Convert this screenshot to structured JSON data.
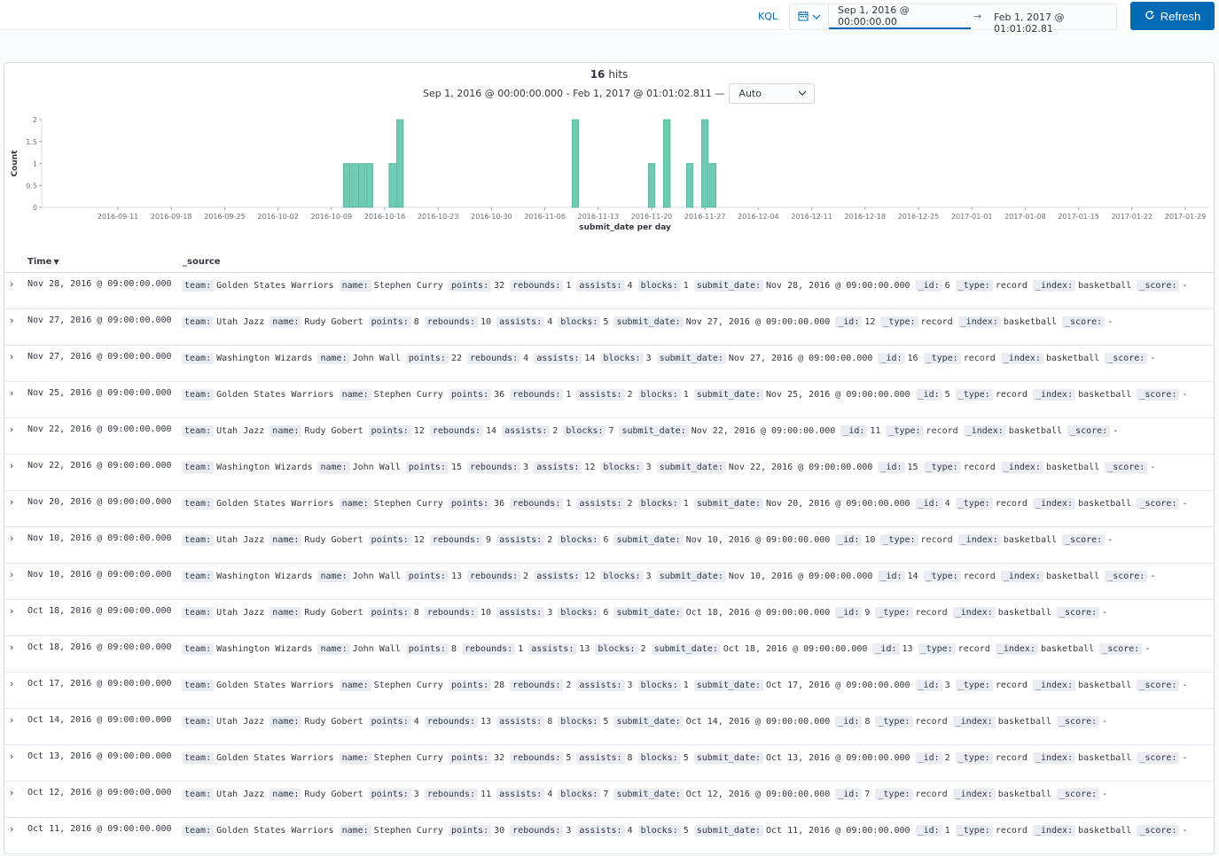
{
  "query_bar": {
    "language": "KQL",
    "date_start": "Sep 1, 2016 @ 00:00:00.00",
    "date_arrow": "→",
    "date_end": "Feb 1, 2017 @ 01:01:02.81",
    "refresh_label": "Refresh"
  },
  "summary": {
    "hits_count": "16",
    "hits_label": "hits",
    "range_text": "Sep 1, 2016 @ 00:00:00.000 - Feb 1, 2017 @ 01:01:02.811 —",
    "interval": "Auto"
  },
  "chart_data": {
    "type": "bar",
    "xlabel": "submit_date per day",
    "ylabel": "Count",
    "ylim": [
      0,
      2
    ],
    "y_ticks": [
      "0",
      "0.5",
      "1",
      "1.5",
      "2"
    ],
    "x_ticks": [
      "2016-09-11",
      "2016-09-18",
      "2016-09-25",
      "2016-10-02",
      "2016-10-09",
      "2016-10-16",
      "2016-10-23",
      "2016-10-30",
      "2016-11-06",
      "2016-11-13",
      "2016-11-20",
      "2016-11-27",
      "2016-12-04",
      "2016-12-11",
      "2016-12-18",
      "2016-12-25",
      "2017-01-01",
      "2017-01-08",
      "2017-01-15",
      "2017-01-22",
      "2017-01-29"
    ],
    "x_start": "2016-09-01",
    "categories": [
      "2016-10-11",
      "2016-10-12",
      "2016-10-13",
      "2016-10-14",
      "2016-10-17",
      "2016-10-18",
      "2016-11-10",
      "2016-11-20",
      "2016-11-22",
      "2016-11-25",
      "2016-11-27",
      "2016-11-28"
    ],
    "values": [
      1,
      1,
      1,
      1,
      1,
      2,
      2,
      1,
      2,
      1,
      2,
      1
    ],
    "color": "#6dccb1"
  },
  "table": {
    "columns": {
      "time": "Time",
      "source": "_source"
    },
    "rows": [
      {
        "time": "Nov 28, 2016 @ 09:00:00.000",
        "fields": [
          [
            "team:",
            "Golden States Warriors"
          ],
          [
            "name:",
            "Stephen Curry"
          ],
          [
            "points:",
            "32"
          ],
          [
            "rebounds:",
            "1"
          ],
          [
            "assists:",
            "4"
          ],
          [
            "blocks:",
            "1"
          ],
          [
            "submit_date:",
            "Nov 28, 2016 @ 09:00:00.000"
          ],
          [
            "_id:",
            "6"
          ],
          [
            "_type:",
            "record"
          ],
          [
            "_index:",
            "basketball"
          ],
          [
            "_score:",
            "-"
          ]
        ]
      },
      {
        "time": "Nov 27, 2016 @ 09:00:00.000",
        "fields": [
          [
            "team:",
            "Utah Jazz"
          ],
          [
            "name:",
            "Rudy Gobert"
          ],
          [
            "points:",
            "8"
          ],
          [
            "rebounds:",
            "10"
          ],
          [
            "assists:",
            "4"
          ],
          [
            "blocks:",
            "5"
          ],
          [
            "submit_date:",
            "Nov 27, 2016 @ 09:00:00.000"
          ],
          [
            "_id:",
            "12"
          ],
          [
            "_type:",
            "record"
          ],
          [
            "_index:",
            "basketball"
          ],
          [
            "_score:",
            "-"
          ]
        ]
      },
      {
        "time": "Nov 27, 2016 @ 09:00:00.000",
        "fields": [
          [
            "team:",
            "Washington Wizards"
          ],
          [
            "name:",
            "John Wall"
          ],
          [
            "points:",
            "22"
          ],
          [
            "rebounds:",
            "4"
          ],
          [
            "assists:",
            "14"
          ],
          [
            "blocks:",
            "3"
          ],
          [
            "submit_date:",
            "Nov 27, 2016 @ 09:00:00.000"
          ],
          [
            "_id:",
            "16"
          ],
          [
            "_type:",
            "record"
          ],
          [
            "_index:",
            "basketball"
          ],
          [
            "_score:",
            "-"
          ]
        ]
      },
      {
        "time": "Nov 25, 2016 @ 09:00:00.000",
        "fields": [
          [
            "team:",
            "Golden States Warriors"
          ],
          [
            "name:",
            "Stephen Curry"
          ],
          [
            "points:",
            "36"
          ],
          [
            "rebounds:",
            "1"
          ],
          [
            "assists:",
            "2"
          ],
          [
            "blocks:",
            "1"
          ],
          [
            "submit_date:",
            "Nov 25, 2016 @ 09:00:00.000"
          ],
          [
            "_id:",
            "5"
          ],
          [
            "_type:",
            "record"
          ],
          [
            "_index:",
            "basketball"
          ],
          [
            "_score:",
            "-"
          ]
        ]
      },
      {
        "time": "Nov 22, 2016 @ 09:00:00.000",
        "fields": [
          [
            "team:",
            "Utah Jazz"
          ],
          [
            "name:",
            "Rudy Gobert"
          ],
          [
            "points:",
            "12"
          ],
          [
            "rebounds:",
            "14"
          ],
          [
            "assists:",
            "2"
          ],
          [
            "blocks:",
            "7"
          ],
          [
            "submit_date:",
            "Nov 22, 2016 @ 09:00:00.000"
          ],
          [
            "_id:",
            "11"
          ],
          [
            "_type:",
            "record"
          ],
          [
            "_index:",
            "basketball"
          ],
          [
            "_score:",
            "-"
          ]
        ]
      },
      {
        "time": "Nov 22, 2016 @ 09:00:00.000",
        "fields": [
          [
            "team:",
            "Washington Wizards"
          ],
          [
            "name:",
            "John Wall"
          ],
          [
            "points:",
            "15"
          ],
          [
            "rebounds:",
            "3"
          ],
          [
            "assists:",
            "12"
          ],
          [
            "blocks:",
            "3"
          ],
          [
            "submit_date:",
            "Nov 22, 2016 @ 09:00:00.000"
          ],
          [
            "_id:",
            "15"
          ],
          [
            "_type:",
            "record"
          ],
          [
            "_index:",
            "basketball"
          ],
          [
            "_score:",
            "-"
          ]
        ]
      },
      {
        "time": "Nov 20, 2016 @ 09:00:00.000",
        "fields": [
          [
            "team:",
            "Golden States Warriors"
          ],
          [
            "name:",
            "Stephen Curry"
          ],
          [
            "points:",
            "36"
          ],
          [
            "rebounds:",
            "1"
          ],
          [
            "assists:",
            "2"
          ],
          [
            "blocks:",
            "1"
          ],
          [
            "submit_date:",
            "Nov 20, 2016 @ 09:00:00.000"
          ],
          [
            "_id:",
            "4"
          ],
          [
            "_type:",
            "record"
          ],
          [
            "_index:",
            "basketball"
          ],
          [
            "_score:",
            "-"
          ]
        ]
      },
      {
        "time": "Nov 10, 2016 @ 09:00:00.000",
        "fields": [
          [
            "team:",
            "Utah Jazz"
          ],
          [
            "name:",
            "Rudy Gobert"
          ],
          [
            "points:",
            "12"
          ],
          [
            "rebounds:",
            "9"
          ],
          [
            "assists:",
            "2"
          ],
          [
            "blocks:",
            "6"
          ],
          [
            "submit_date:",
            "Nov 10, 2016 @ 09:00:00.000"
          ],
          [
            "_id:",
            "10"
          ],
          [
            "_type:",
            "record"
          ],
          [
            "_index:",
            "basketball"
          ],
          [
            "_score:",
            "-"
          ]
        ]
      },
      {
        "time": "Nov 10, 2016 @ 09:00:00.000",
        "fields": [
          [
            "team:",
            "Washington Wizards"
          ],
          [
            "name:",
            "John Wall"
          ],
          [
            "points:",
            "13"
          ],
          [
            "rebounds:",
            "2"
          ],
          [
            "assists:",
            "12"
          ],
          [
            "blocks:",
            "3"
          ],
          [
            "submit_date:",
            "Nov 10, 2016 @ 09:00:00.000"
          ],
          [
            "_id:",
            "14"
          ],
          [
            "_type:",
            "record"
          ],
          [
            "_index:",
            "basketball"
          ],
          [
            "_score:",
            "-"
          ]
        ]
      },
      {
        "time": "Oct 18, 2016 @ 09:00:00.000",
        "fields": [
          [
            "team:",
            "Utah Jazz"
          ],
          [
            "name:",
            "Rudy Gobert"
          ],
          [
            "points:",
            "8"
          ],
          [
            "rebounds:",
            "10"
          ],
          [
            "assists:",
            "3"
          ],
          [
            "blocks:",
            "6"
          ],
          [
            "submit_date:",
            "Oct 18, 2016 @ 09:00:00.000"
          ],
          [
            "_id:",
            "9"
          ],
          [
            "_type:",
            "record"
          ],
          [
            "_index:",
            "basketball"
          ],
          [
            "_score:",
            "-"
          ]
        ]
      },
      {
        "time": "Oct 18, 2016 @ 09:00:00.000",
        "fields": [
          [
            "team:",
            "Washington Wizards"
          ],
          [
            "name:",
            "John Wall"
          ],
          [
            "points:",
            "8"
          ],
          [
            "rebounds:",
            "1"
          ],
          [
            "assists:",
            "13"
          ],
          [
            "blocks:",
            "2"
          ],
          [
            "submit_date:",
            "Oct 18, 2016 @ 09:00:00.000"
          ],
          [
            "_id:",
            "13"
          ],
          [
            "_type:",
            "record"
          ],
          [
            "_index:",
            "basketball"
          ],
          [
            "_score:",
            "-"
          ]
        ]
      },
      {
        "time": "Oct 17, 2016 @ 09:00:00.000",
        "fields": [
          [
            "team:",
            "Golden States Warriors"
          ],
          [
            "name:",
            "Stephen Curry"
          ],
          [
            "points:",
            "28"
          ],
          [
            "rebounds:",
            "2"
          ],
          [
            "assists:",
            "3"
          ],
          [
            "blocks:",
            "1"
          ],
          [
            "submit_date:",
            "Oct 17, 2016 @ 09:00:00.000"
          ],
          [
            "_id:",
            "3"
          ],
          [
            "_type:",
            "record"
          ],
          [
            "_index:",
            "basketball"
          ],
          [
            "_score:",
            "-"
          ]
        ]
      },
      {
        "time": "Oct 14, 2016 @ 09:00:00.000",
        "fields": [
          [
            "team:",
            "Utah Jazz"
          ],
          [
            "name:",
            "Rudy Gobert"
          ],
          [
            "points:",
            "4"
          ],
          [
            "rebounds:",
            "13"
          ],
          [
            "assists:",
            "8"
          ],
          [
            "blocks:",
            "5"
          ],
          [
            "submit_date:",
            "Oct 14, 2016 @ 09:00:00.000"
          ],
          [
            "_id:",
            "8"
          ],
          [
            "_type:",
            "record"
          ],
          [
            "_index:",
            "basketball"
          ],
          [
            "_score:",
            "-"
          ]
        ]
      },
      {
        "time": "Oct 13, 2016 @ 09:00:00.000",
        "fields": [
          [
            "team:",
            "Golden States Warriors"
          ],
          [
            "name:",
            "Stephen Curry"
          ],
          [
            "points:",
            "32"
          ],
          [
            "rebounds:",
            "5"
          ],
          [
            "assists:",
            "8"
          ],
          [
            "blocks:",
            "5"
          ],
          [
            "submit_date:",
            "Oct 13, 2016 @ 09:00:00.000"
          ],
          [
            "_id:",
            "2"
          ],
          [
            "_type:",
            "record"
          ],
          [
            "_index:",
            "basketball"
          ],
          [
            "_score:",
            "-"
          ]
        ]
      },
      {
        "time": "Oct 12, 2016 @ 09:00:00.000",
        "fields": [
          [
            "team:",
            "Utah Jazz"
          ],
          [
            "name:",
            "Rudy Gobert"
          ],
          [
            "points:",
            "3"
          ],
          [
            "rebounds:",
            "11"
          ],
          [
            "assists:",
            "4"
          ],
          [
            "blocks:",
            "7"
          ],
          [
            "submit_date:",
            "Oct 12, 2016 @ 09:00:00.000"
          ],
          [
            "_id:",
            "7"
          ],
          [
            "_type:",
            "record"
          ],
          [
            "_index:",
            "basketball"
          ],
          [
            "_score:",
            "-"
          ]
        ]
      },
      {
        "time": "Oct 11, 2016 @ 09:00:00.000",
        "fields": [
          [
            "team:",
            "Golden States Warriors"
          ],
          [
            "name:",
            "Stephen Curry"
          ],
          [
            "points:",
            "30"
          ],
          [
            "rebounds:",
            "3"
          ],
          [
            "assists:",
            "4"
          ],
          [
            "blocks:",
            "5"
          ],
          [
            "submit_date:",
            "Oct 11, 2016 @ 09:00:00.000"
          ],
          [
            "_id:",
            "1"
          ],
          [
            "_type:",
            "record"
          ],
          [
            "_index:",
            "basketball"
          ],
          [
            "_score:",
            "-"
          ]
        ]
      }
    ]
  }
}
